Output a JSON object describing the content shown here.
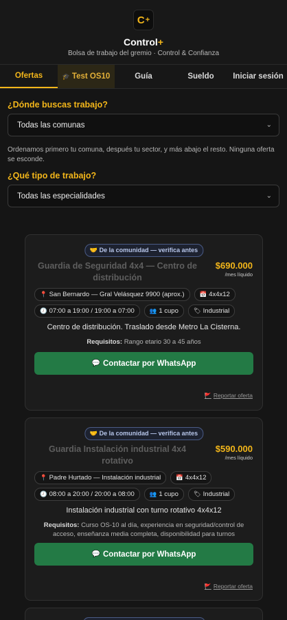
{
  "app": {
    "logo_text": "C",
    "logo_plus": "+",
    "brand_name": "Control",
    "brand_suffix": "+",
    "tagline": "Bolsa de trabajo del gremio · Control & Confianza"
  },
  "tabs": [
    {
      "label": "Ofertas",
      "active": true
    },
    {
      "label": "Test OS10",
      "icon": "graduation-cap-icon"
    },
    {
      "label": "Guía"
    },
    {
      "label": "Sueldo"
    },
    {
      "label": "Iniciar sesión"
    }
  ],
  "filters": {
    "location_question": "¿Dónde buscas trabajo?",
    "location_value": "Todas las comunas",
    "note": "Ordenamos primero tu comuna, después tu sector, y más abajo el resto. Ninguna oferta se esconde.",
    "type_question": "¿Qué tipo de trabajo?",
    "type_value": "Todas las especialidades"
  },
  "offers": [
    {
      "badge": "De la comunidad — verifica antes",
      "title": "Guardia de Seguridad 4x4 — Centro de distribución",
      "price": "$690.000",
      "price_unit": "/mes líquido",
      "location": "San Bernardo — Gral Velásquez 9900 (aprox.)",
      "shift": "4x4x12",
      "schedule": "07:00 a 19:00 / 19:00 a 07:00",
      "slots": "1 cupo",
      "sector": "Industrial",
      "description": "Centro de distribución. Traslado desde Metro La Cisterna.",
      "requirements_label": "Requisitos:",
      "requirements": "Rango etario 30 a 45 años",
      "contact_label": "Contactar por WhatsApp",
      "report_label": "Reportar oferta"
    },
    {
      "badge": "De la comunidad — verifica antes",
      "title": "Guardia Instalación industrial 4x4 rotativo",
      "price": "$590.000",
      "price_unit": "/mes líquido",
      "location": "Padre Hurtado — Instalación industrial",
      "shift": "4x4x12",
      "schedule": "08:00 a 20:00 / 20:00 a 08:00",
      "slots": "1 cupo",
      "sector": "Industrial",
      "description": "Instalación industrial con turno rotativo 4x4x12",
      "requirements_label": "Requisitos:",
      "requirements": "Curso OS-10 al día, experiencia en seguridad/control de acceso, enseñanza media completa, disponibilidad para turnos",
      "contact_label": "Contactar por WhatsApp",
      "report_label": "Reportar oferta"
    }
  ],
  "colors": {
    "accent": "#f3b61a",
    "whatsapp": "#237a45",
    "background": "#151515",
    "card": "#1c1c1c"
  }
}
